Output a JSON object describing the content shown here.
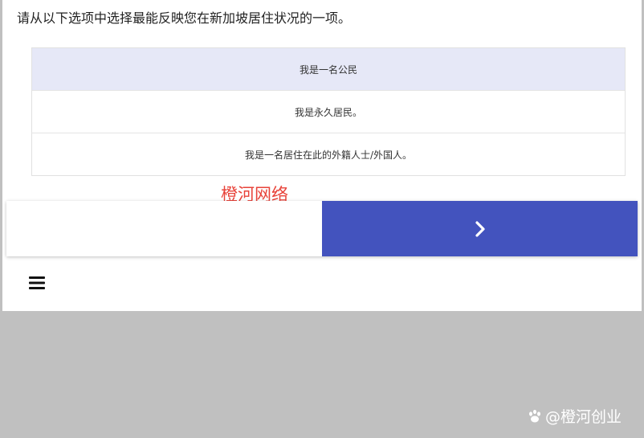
{
  "question": {
    "text": "请从以下选项中选择最能反映您在新加坡居住状况的一项。"
  },
  "options": [
    {
      "label": "我是一名公民",
      "selected": true
    },
    {
      "label": "我是永久居民。",
      "selected": false
    },
    {
      "label": "我是一名居住在此的外籍人士/外国人。",
      "selected": false
    }
  ],
  "overlay_watermark": "橙河网络",
  "navigation": {
    "back_icon": "blank",
    "next_icon": "chevron-right-icon"
  },
  "menu": {
    "icon": "hamburger-menu-icon"
  },
  "bottom_watermark": {
    "icon": "paw-icon",
    "text": "@橙河创业"
  },
  "colors": {
    "accent": "#4353be",
    "selected_option_bg": "#e6e8f7",
    "page_bg": "#c0c0c0",
    "watermark_red": "#e8433a"
  }
}
